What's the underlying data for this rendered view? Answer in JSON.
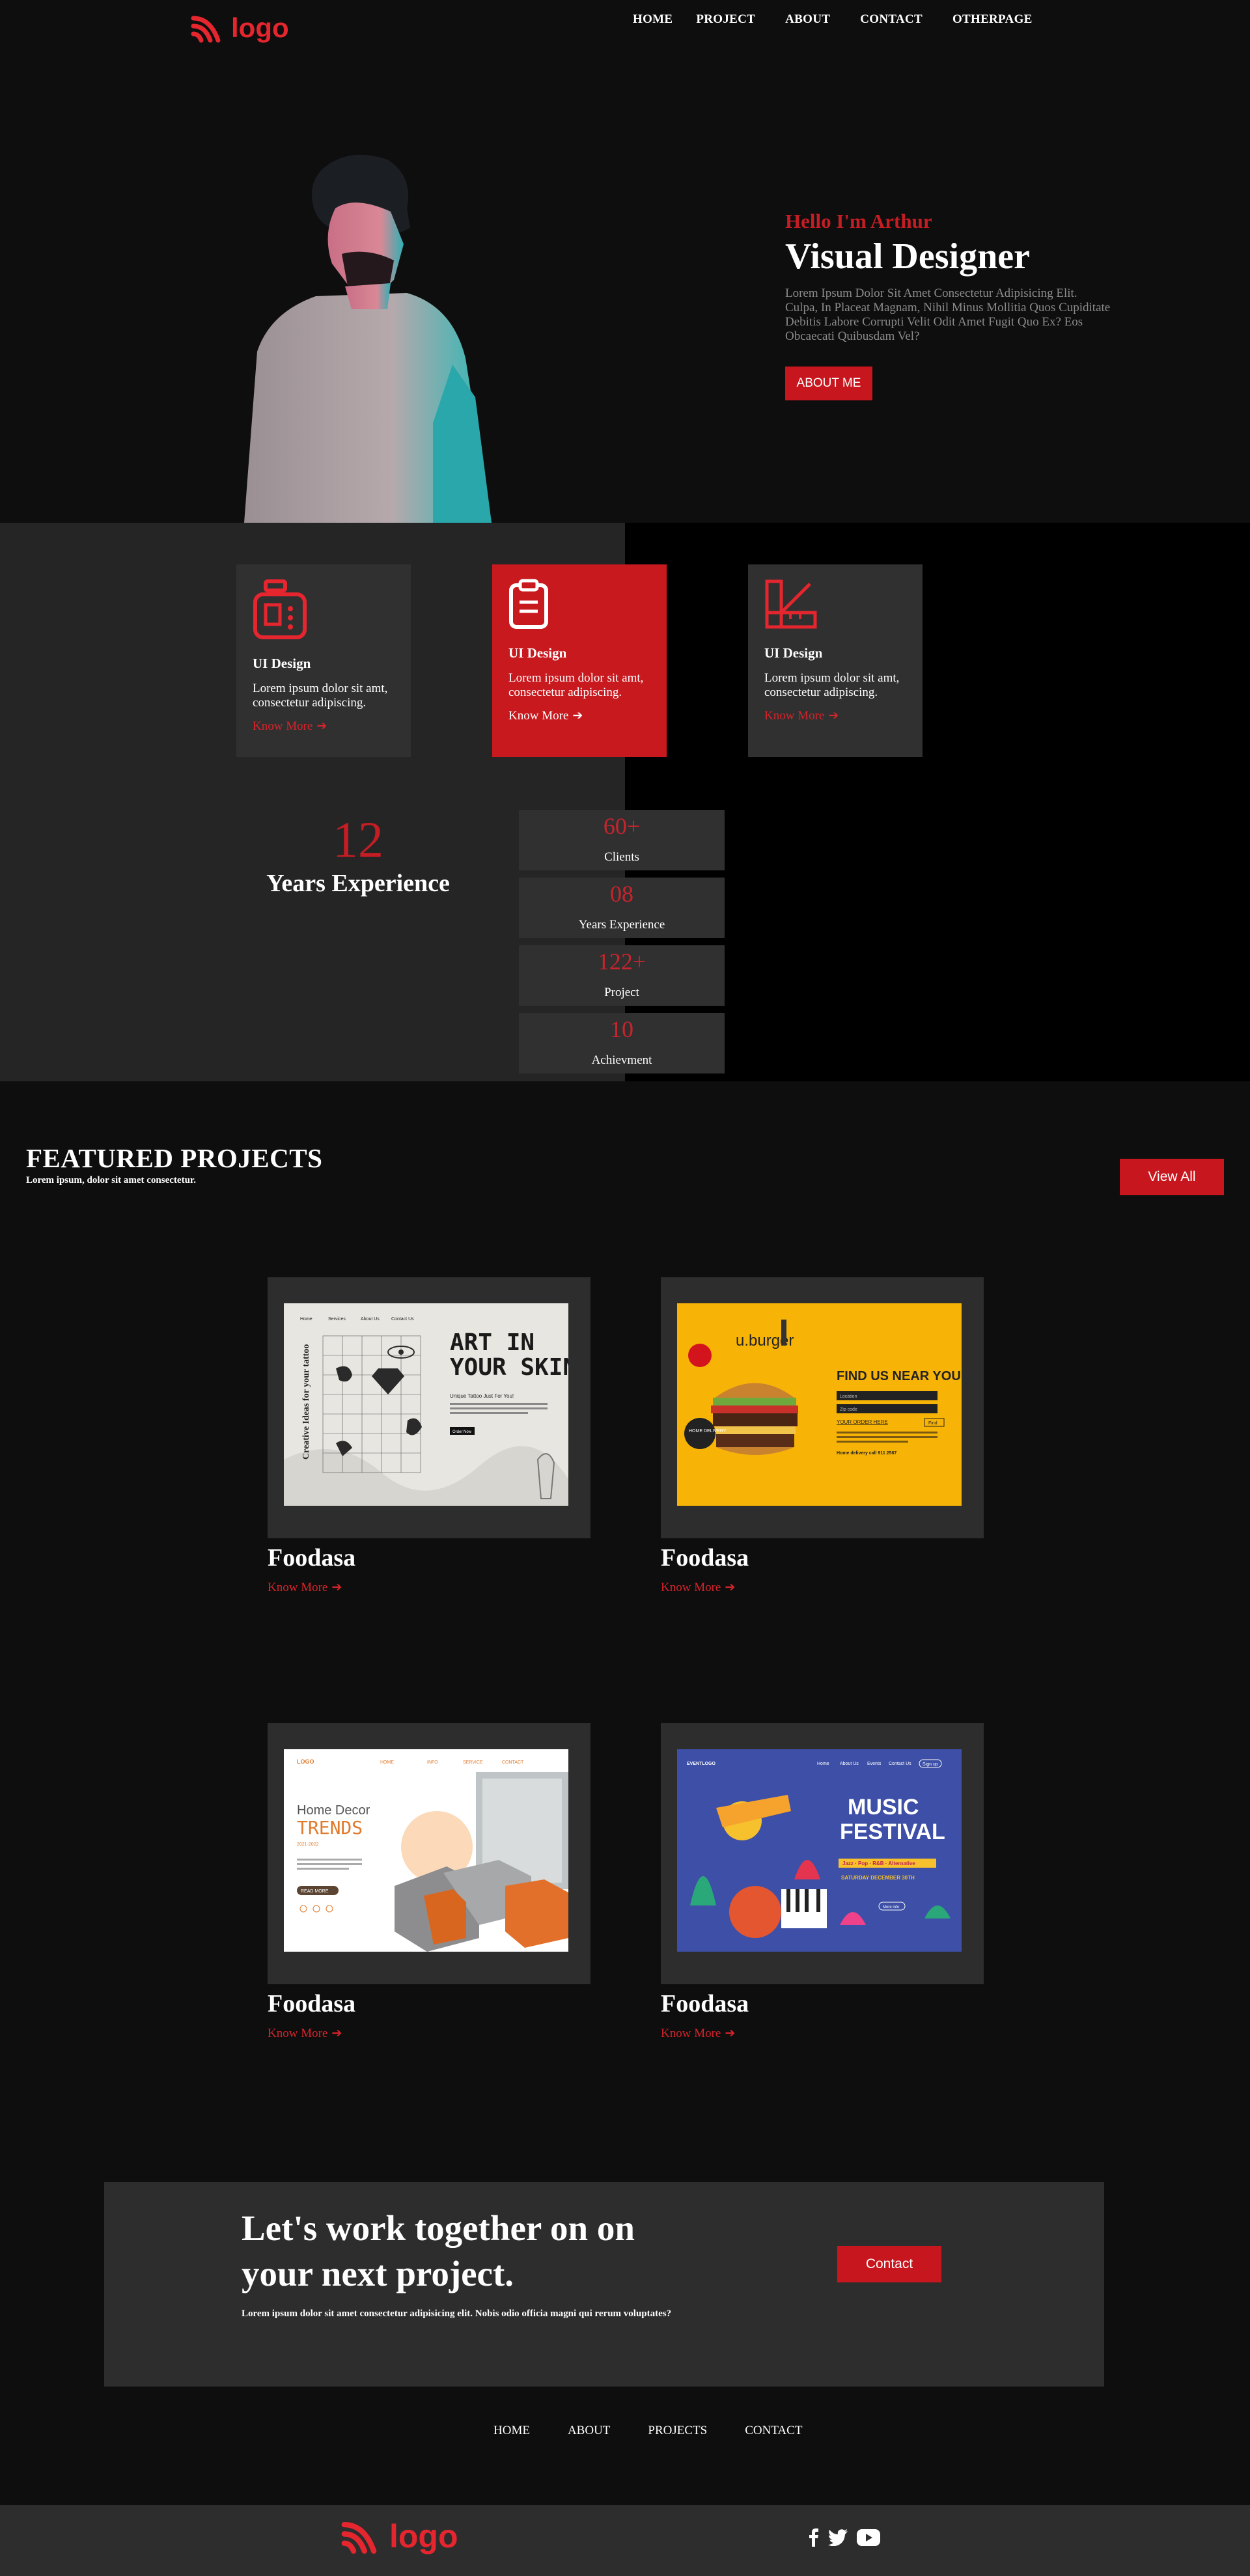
{
  "brand": {
    "logo_text": "logo",
    "accent": "#e5262e",
    "red": "#c8161e"
  },
  "nav": [
    {
      "label": "HOME"
    },
    {
      "label": "PROJECT"
    },
    {
      "label": "ABOUT"
    },
    {
      "label": "CONTACT"
    },
    {
      "label": "OTHERPAGE"
    }
  ],
  "hero": {
    "greeting": "Hello I'm Arthur",
    "title": "Visual Designer",
    "description": "Lorem Ipsum Dolor Sit Amet Consectetur Adipisicing Elit. Culpa, In Placeat Magnam, Nihil Minus Mollitia Quos Cupiditate Debitis Labore Corrupti Velit Odit Amet Fugit Quo Ex? Eos Obcaecati Quibusdam Vel?",
    "button": "ABOUT ME"
  },
  "services": [
    {
      "icon": "device-icon",
      "title": "UI Design",
      "text": "Lorem ipsum dolor sit amt, consectetur adipiscing.",
      "link": "Know More"
    },
    {
      "icon": "clipboard-icon",
      "title": "UI Design",
      "text": "Lorem ipsum dolor sit amt, consectetur adipiscing.",
      "link": "Know More"
    },
    {
      "icon": "ruler-icon",
      "title": "UI Design",
      "text": "Lorem ipsum dolor sit amt, consectetur adipiscing.",
      "link": "Know More"
    }
  ],
  "experience": {
    "number": "12",
    "label": "Years Experience"
  },
  "stats": [
    {
      "value": "60+",
      "label": "Clients"
    },
    {
      "value": "08",
      "label": "Years Experience"
    },
    {
      "value": "122+",
      "label": "Project"
    },
    {
      "value": "10",
      "label": "Achievment"
    }
  ],
  "featured": {
    "title": "FEATURED PROJECTS",
    "subtitle": "Lorem ipsum, dolor sit amet consectetur.",
    "view_all": "View All",
    "projects": [
      {
        "title": "Foodasa",
        "link": "Know More",
        "thumb": {
          "headline1": "ART IN",
          "headline2": "YOUR SKIN",
          "nav": [
            "Home",
            "Services",
            "About Us",
            "Contact Us"
          ],
          "side": "Creative Ideas for your tattoo",
          "sub": "Unique Tattoo Just For You!",
          "btn": "Order Now"
        }
      },
      {
        "title": "Foodasa",
        "link": "Know More",
        "thumb": {
          "brand": "u.burger",
          "headline": "FIND US NEAR YOU",
          "badge": "HOME DELIVERY",
          "field1": "Location",
          "field2": "Zip code",
          "cta": "YOUR ORDER HERE",
          "btn": "Find",
          "footer": "Home delivery call 911 2567"
        }
      },
      {
        "title": "Foodasa",
        "link": "Know More",
        "thumb": {
          "brand": "LOGO",
          "line1": "Home Decor",
          "line2": "TRENDS",
          "sub": "2021-2022",
          "btn": "READ MORE",
          "nav": [
            "HOME",
            "INFO",
            "SERVICE",
            "CONTACT"
          ]
        }
      },
      {
        "title": "Foodasa",
        "link": "Know More",
        "thumb": {
          "brand": "EVENTLOGO",
          "line1": "MUSIC",
          "line2": "FESTIVAL",
          "genres": "Jazz · Pop · R&B · Alternative",
          "date": "SATURDAY DECEMBER 30TH",
          "btn": "More info",
          "nav": [
            "Home",
            "About Us",
            "Events",
            "Contact Us",
            "Sign up"
          ]
        }
      }
    ]
  },
  "cta": {
    "title": "Let's work together on on your next project.",
    "text": "Lorem ipsum dolor sit amet consectetur adipisicing elit. Nobis odio officia magni qui rerum voluptates?",
    "button": "Contact"
  },
  "footer_nav": [
    {
      "label": "HOME"
    },
    {
      "label": "ABOUT"
    },
    {
      "label": "PROJECTS"
    },
    {
      "label": "CONTACT"
    }
  ],
  "footer": {
    "logo_text": "logo",
    "social": [
      "facebook-icon",
      "twitter-icon",
      "youtube-icon"
    ]
  }
}
